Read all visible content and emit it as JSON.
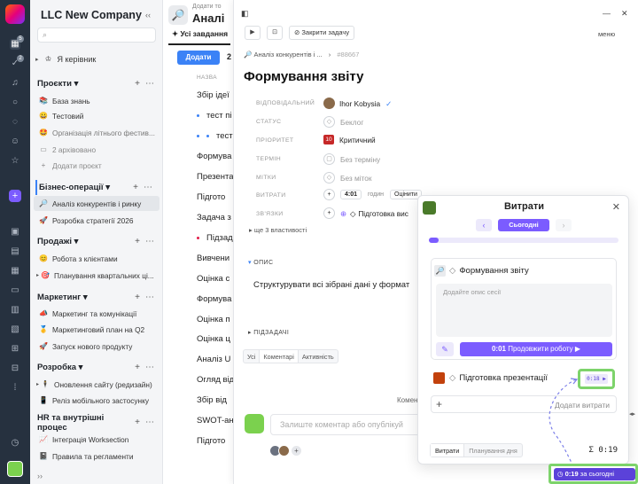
{
  "rail": {
    "badges": [
      "5",
      "2"
    ]
  },
  "sidebar": {
    "title": "LLC New Company",
    "collapse": "‹‹",
    "my_manager": "Я керівник",
    "projects": {
      "heading": "Проєкти ▾",
      "items": [
        {
          "label": "База знань",
          "icon": "📚"
        },
        {
          "label": "Тестовий",
          "icon": "😀"
        },
        {
          "label": "Організація літнього фестив...",
          "icon": "🤩"
        },
        {
          "label": "2 архівовано",
          "icon": "▭"
        },
        {
          "label": "Додати проєкт",
          "icon": "+"
        }
      ]
    },
    "biz": {
      "heading": "Бізнес-операції ▾",
      "items": [
        {
          "label": "Аналіз конкурентів і ринку",
          "icon": "🔎"
        },
        {
          "label": "Розробка стратегії 2026",
          "icon": "🚀"
        }
      ]
    },
    "sales": {
      "heading": "Продажі ▾",
      "items": [
        {
          "label": "Робота з клієнтами",
          "icon": "😊"
        },
        {
          "label": "Планування квартальних ці...",
          "icon": "🎯"
        }
      ]
    },
    "marketing": {
      "heading": "Маркетинг ▾",
      "items": [
        {
          "label": "Маркетинг та комунікації",
          "icon": "📣"
        },
        {
          "label": "Маркетинговий план на Q2",
          "icon": "🥇"
        },
        {
          "label": "Запуск нового продукту",
          "icon": "🚀"
        }
      ]
    },
    "dev": {
      "heading": "Розробка ▾",
      "items": [
        {
          "label": "Оновлення сайту (редизайн)",
          "icon": "🕴"
        },
        {
          "label": "Реліз мобільного застосунку",
          "icon": "📱"
        }
      ]
    },
    "hr": {
      "heading": "HR та внутрішні процес",
      "items": [
        {
          "label": "Інтеграція Worksection",
          "icon": "📈"
        },
        {
          "label": "Правила та регламенти",
          "icon": "📓"
        }
      ]
    },
    "bottom": "››"
  },
  "main": {
    "sub": "Додати то",
    "title": "Аналі",
    "tab": "✦ Усі завдання",
    "add": "Додати",
    "count": "2",
    "col_header": "НАЗВА",
    "tasks": [
      {
        "label": "Збір ідеї",
        "dot": ""
      },
      {
        "label": "тест пі",
        "dot": "blue"
      },
      {
        "label": "тест",
        "dot": "blue2"
      },
      {
        "label": "Формува",
        "dot": ""
      },
      {
        "label": "Презента",
        "dot": ""
      },
      {
        "label": "Підгото",
        "dot": ""
      },
      {
        "label": "Задача з",
        "dot": ""
      },
      {
        "label": "Підзад",
        "dot": "red"
      },
      {
        "label": "Вивчени",
        "dot": ""
      },
      {
        "label": "Оцінка с",
        "dot": ""
      },
      {
        "label": "Формува",
        "dot": ""
      },
      {
        "label": "Оцінка п",
        "dot": ""
      },
      {
        "label": "Оцінка ц",
        "dot": ""
      },
      {
        "label": "Аналіз U",
        "dot": ""
      },
      {
        "label": "Огляд від",
        "dot": ""
      },
      {
        "label": "Збір від",
        "dot": ""
      },
      {
        "label": "SWOT-ан",
        "dot": ""
      },
      {
        "label": "Підгото",
        "dot": ""
      }
    ]
  },
  "detail": {
    "close_task": "Закрити задачу",
    "menu": "меню",
    "breadcrumb": "Аналіз конкурентів і ...",
    "breadcrumb_sep": "›",
    "task_id": "#88667",
    "title": "Формування звіту",
    "props": {
      "assignee_label": "ВІДПОВІДАЛЬНИЙ",
      "assignee": "Ihor Kobysia",
      "status_label": "СТАТУС",
      "status": "Беклог",
      "priority_label": "ПРІОРИТЕТ",
      "priority_num": "10",
      "priority": "Критичний",
      "term_label": "ТЕРМІН",
      "term": "Без терміну",
      "tags_label": "МІТКИ",
      "tags": "Без міток",
      "costs_label": "ВИТРАТИ",
      "costs_time": "4:01",
      "costs_unit": "годин",
      "costs_estimate": "Оцінити",
      "links_label": "ЗВ'ЯЗКИ",
      "links": "Підготовка вис"
    },
    "more": "ще 3 властивості",
    "desc_label": "ОПИС",
    "desc": "Структурувати всі зібрані дані у формат",
    "subtasks_label": "ПІДЗАДАЧІ",
    "tabs": [
      "Усі",
      "Коментарі",
      "Активність"
    ],
    "comment_word": "Комен",
    "comment_placeholder": "Залиште коментар або опублікуй"
  },
  "costs": {
    "title": "Витрати",
    "prev": "‹",
    "today": "Сьогодні",
    "next": "›",
    "progress": 0.05,
    "task1": "Формування звіту",
    "placeholder": "Додайте опис сесії",
    "continue_time": "0:01",
    "continue_label": "Продовжити роботу ▶",
    "task2": "Підготовка презентації",
    "task2_time": "0:18 ▶",
    "add_label": "Додати витрати",
    "tabs": [
      "Витрати",
      "Планування дня"
    ],
    "total": "Σ 0:19"
  },
  "timer": {
    "time": "0:19",
    "label": "за сьогодні"
  }
}
